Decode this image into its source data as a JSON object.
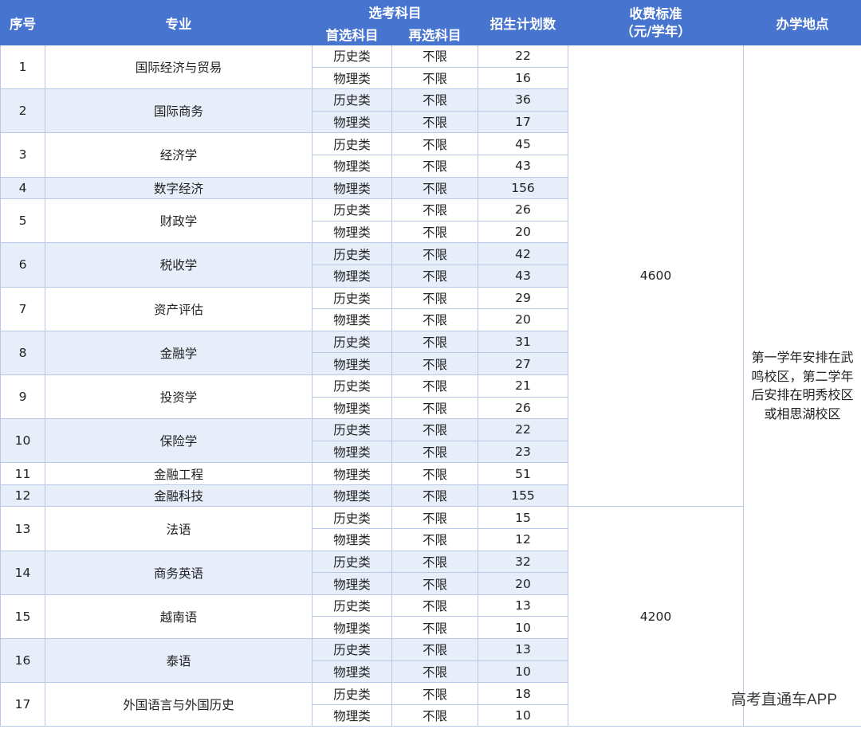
{
  "header": {
    "no": "序号",
    "major": "专业",
    "subjects": "选考科目",
    "primary": "首选科目",
    "secondary": "再选科目",
    "quota": "招生计划数",
    "fee_line1": "收费标准",
    "fee_line2": "（元/学年）",
    "location": "办学地点"
  },
  "majors": [
    {
      "no": "1",
      "name": "国际经济与贸易",
      "rows": [
        {
          "primary": "历史类",
          "secondary": "不限",
          "quota": "22"
        },
        {
          "primary": "物理类",
          "secondary": "不限",
          "quota": "16"
        }
      ]
    },
    {
      "no": "2",
      "name": "国际商务",
      "rows": [
        {
          "primary": "历史类",
          "secondary": "不限",
          "quota": "36"
        },
        {
          "primary": "物理类",
          "secondary": "不限",
          "quota": "17"
        }
      ]
    },
    {
      "no": "3",
      "name": "经济学",
      "rows": [
        {
          "primary": "历史类",
          "secondary": "不限",
          "quota": "45"
        },
        {
          "primary": "物理类",
          "secondary": "不限",
          "quota": "43"
        }
      ]
    },
    {
      "no": "4",
      "name": "数字经济",
      "rows": [
        {
          "primary": "物理类",
          "secondary": "不限",
          "quota": "156"
        }
      ]
    },
    {
      "no": "5",
      "name": "财政学",
      "rows": [
        {
          "primary": "历史类",
          "secondary": "不限",
          "quota": "26"
        },
        {
          "primary": "物理类",
          "secondary": "不限",
          "quota": "20"
        }
      ]
    },
    {
      "no": "6",
      "name": "税收学",
      "rows": [
        {
          "primary": "历史类",
          "secondary": "不限",
          "quota": "42"
        },
        {
          "primary": "物理类",
          "secondary": "不限",
          "quota": "43"
        }
      ]
    },
    {
      "no": "7",
      "name": "资产评估",
      "rows": [
        {
          "primary": "历史类",
          "secondary": "不限",
          "quota": "29"
        },
        {
          "primary": "物理类",
          "secondary": "不限",
          "quota": "20"
        }
      ]
    },
    {
      "no": "8",
      "name": "金融学",
      "rows": [
        {
          "primary": "历史类",
          "secondary": "不限",
          "quota": "31"
        },
        {
          "primary": "物理类",
          "secondary": "不限",
          "quota": "27"
        }
      ]
    },
    {
      "no": "9",
      "name": "投资学",
      "rows": [
        {
          "primary": "历史类",
          "secondary": "不限",
          "quota": "21"
        },
        {
          "primary": "物理类",
          "secondary": "不限",
          "quota": "26"
        }
      ]
    },
    {
      "no": "10",
      "name": "保险学",
      "rows": [
        {
          "primary": "历史类",
          "secondary": "不限",
          "quota": "22"
        },
        {
          "primary": "物理类",
          "secondary": "不限",
          "quota": "23"
        }
      ]
    },
    {
      "no": "11",
      "name": "金融工程",
      "rows": [
        {
          "primary": "物理类",
          "secondary": "不限",
          "quota": "51"
        }
      ]
    },
    {
      "no": "12",
      "name": "金融科技",
      "rows": [
        {
          "primary": "物理类",
          "secondary": "不限",
          "quota": "155"
        }
      ]
    },
    {
      "no": "13",
      "name": "法语",
      "rows": [
        {
          "primary": "历史类",
          "secondary": "不限",
          "quota": "15"
        },
        {
          "primary": "物理类",
          "secondary": "不限",
          "quota": "12"
        }
      ]
    },
    {
      "no": "14",
      "name": "商务英语",
      "rows": [
        {
          "primary": "历史类",
          "secondary": "不限",
          "quota": "32"
        },
        {
          "primary": "物理类",
          "secondary": "不限",
          "quota": "20"
        }
      ]
    },
    {
      "no": "15",
      "name": "越南语",
      "rows": [
        {
          "primary": "历史类",
          "secondary": "不限",
          "quota": "13"
        },
        {
          "primary": "物理类",
          "secondary": "不限",
          "quota": "10"
        }
      ]
    },
    {
      "no": "16",
      "name": "泰语",
      "rows": [
        {
          "primary": "历史类",
          "secondary": "不限",
          "quota": "13"
        },
        {
          "primary": "物理类",
          "secondary": "不限",
          "quota": "10"
        }
      ]
    },
    {
      "no": "17",
      "name": "外国语言与外国历史",
      "rows": [
        {
          "primary": "历史类",
          "secondary": "不限",
          "quota": "18"
        },
        {
          "primary": "物理类",
          "secondary": "不限",
          "quota": "10"
        }
      ]
    }
  ],
  "fee_groups": [
    {
      "fee": "4600",
      "through_major": 12
    },
    {
      "fee": "4200",
      "through_major": 17
    }
  ],
  "location": "第一学年安排在武鸣校区，第二学年后安排在明秀校区或相思湖校区",
  "watermark": "高考直通车APP",
  "colors": {
    "header_bg": "#4674cf",
    "band_bg": "#e7eef9",
    "border": "#b8c8e6"
  }
}
